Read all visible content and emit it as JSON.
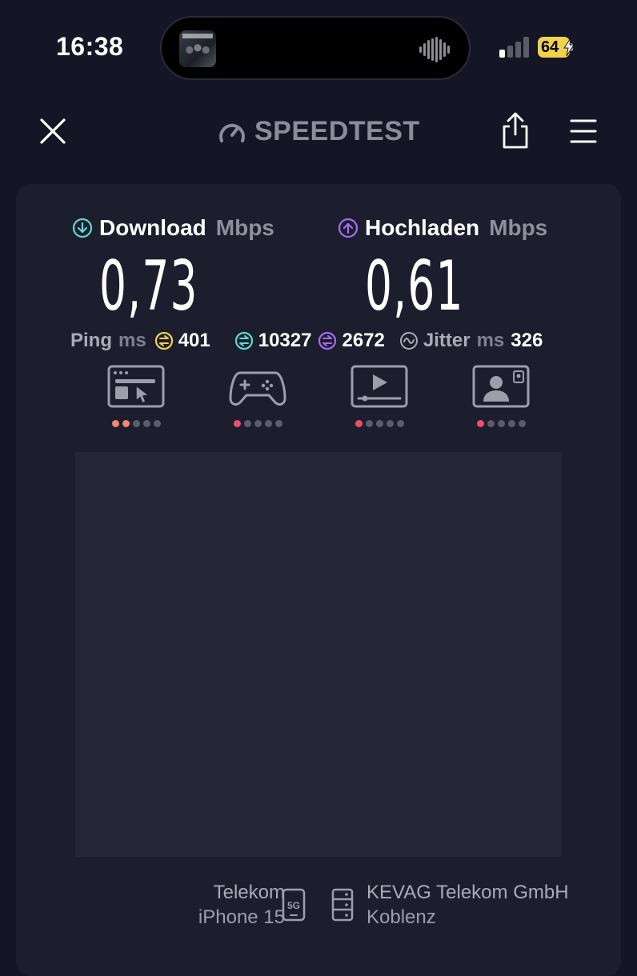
{
  "status_bar": {
    "time": "16:38",
    "battery_level": "64",
    "signal_bars_active": 1,
    "signal_bars_total": 4,
    "now_playing_icon": "album-art-icon"
  },
  "header": {
    "brand": "SPEEDTEST",
    "close_icon": "close-icon",
    "share_icon": "share-icon",
    "menu_icon": "menu-icon"
  },
  "download": {
    "label": "Download",
    "unit": "Mbps",
    "value": "0,73",
    "color": "#5fd8d0"
  },
  "upload": {
    "label": "Hochladen",
    "unit": "Mbps",
    "value": "0,61",
    "color": "#a66bf2"
  },
  "stats": {
    "ping_label": "Ping",
    "ping_unit": "ms",
    "ping_idle": "401",
    "ping_download": "10327",
    "ping_upload": "2672",
    "jitter_label": "Jitter",
    "jitter_unit": "ms",
    "jitter_value": "326",
    "idle_color": "#f2d24a",
    "download_color": "#5fd8d0",
    "upload_color": "#a66bf2"
  },
  "quality": [
    {
      "name": "web-browsing-icon",
      "rating": 2,
      "color": "#f08a6e"
    },
    {
      "name": "gaming-icon",
      "rating": 1,
      "color": "#ef4f6a"
    },
    {
      "name": "video-streaming-icon",
      "rating": 1,
      "color": "#ef4f6a"
    },
    {
      "name": "video-chat-icon",
      "rating": 1,
      "color": "#ef4f6a"
    }
  ],
  "footer": {
    "provider": "Telekom",
    "device": "iPhone 15",
    "network_type": "5G",
    "server_name": "KEVAG Telekom GmbH",
    "server_location": "Koblenz"
  },
  "colors": {
    "background": "#141625",
    "card": "#1c1e2e",
    "graph": "#252737",
    "battery": "#f2d24a"
  }
}
